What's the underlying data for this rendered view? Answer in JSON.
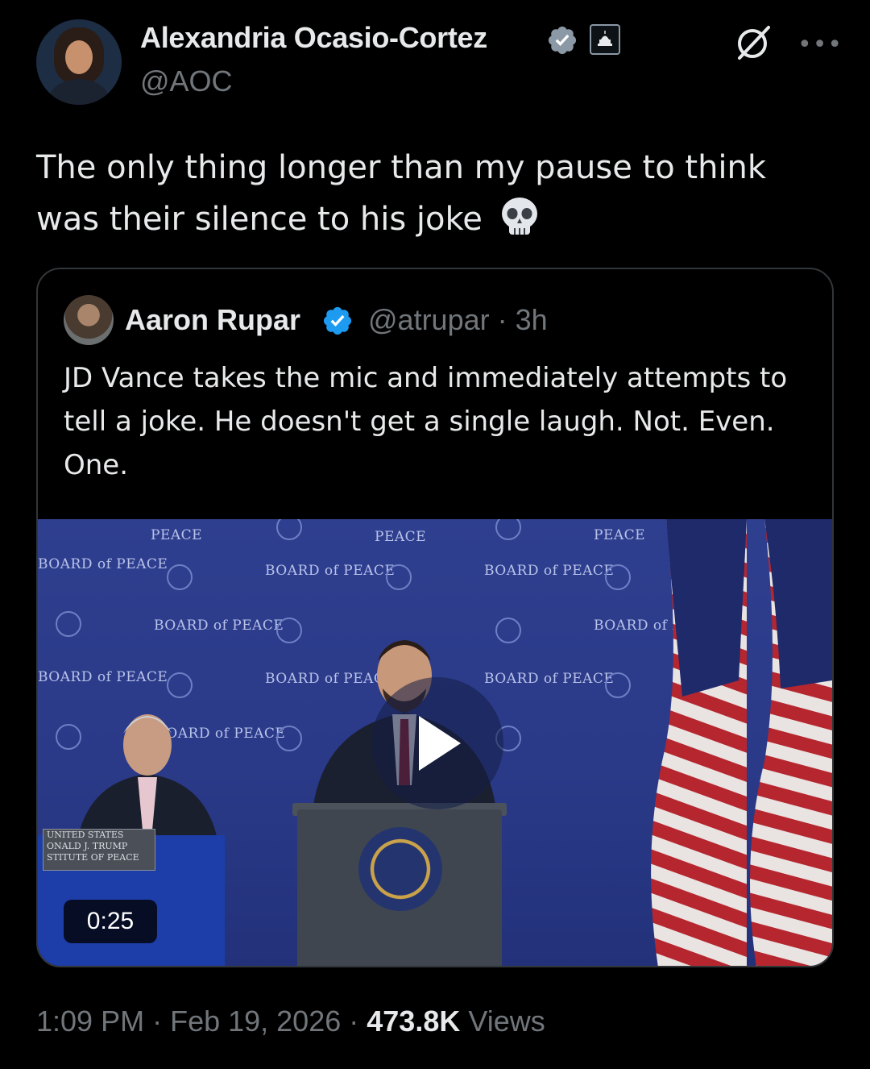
{
  "author": {
    "display_name": "Alexandria Ocasio-Cortez",
    "handle": "@AOC",
    "verified_icon": "verified-badge-icon",
    "affiliation_icon": "capitol-badge-icon"
  },
  "header_actions": {
    "grok_icon": "grok-icon",
    "more_icon": "more-icon",
    "more_glyph": "•••"
  },
  "tweet": {
    "text": "The only thing longer than my pause to think was their silence to his joke",
    "emoji_icon": "skull-icon"
  },
  "quoted_tweet": {
    "display_name": "Aaron Rupar",
    "handle_time": "@atrupar · 3h",
    "text": "JD Vance takes the mic and immediately attempts to tell a joke. He doesn't get a single laugh. Not. Even. One.",
    "video": {
      "duration": "0:25",
      "backdrop_text": "BOARD of PEACE",
      "backdrop_short": "PEACE",
      "nameplate_line1": "UNITED STATES",
      "nameplate_line2": "ONALD J. TRUMP",
      "nameplate_line3": "STITUTE OF PEACE"
    }
  },
  "footer": {
    "time": "1:09 PM",
    "separator": " · ",
    "date": "Feb 19, 2026",
    "views_count": "473.8K",
    "views_label": "Views"
  },
  "colors": {
    "background": "#000000",
    "text_primary": "#e7e9ea",
    "text_secondary": "#71767b",
    "verified_blue": "#1d9bf0",
    "border": "#333639"
  }
}
